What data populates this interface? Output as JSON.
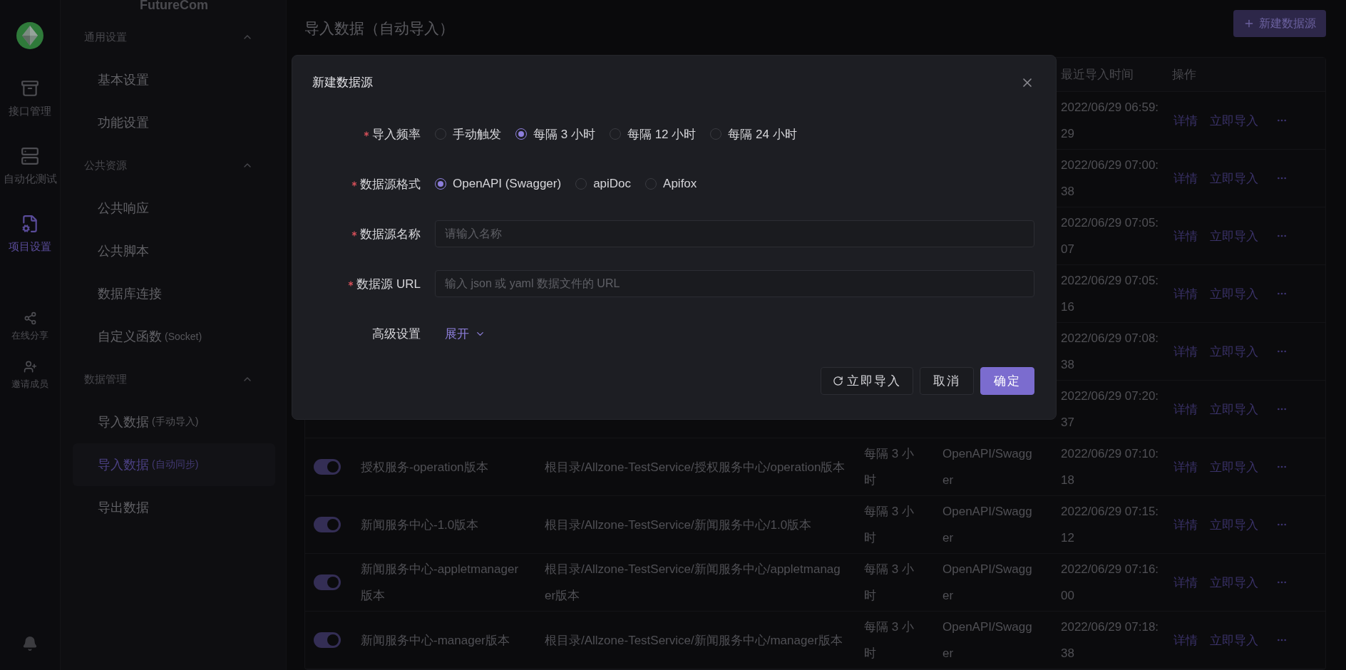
{
  "rail": {
    "nav": [
      {
        "kind": "api",
        "label": "接口管理",
        "selected": false
      },
      {
        "kind": "test",
        "label": "自动化测试",
        "selected": false
      },
      {
        "kind": "settings",
        "label": "项目设置",
        "selected": true
      }
    ],
    "tools": [
      {
        "kind": "share",
        "label": "在线分享"
      },
      {
        "kind": "invite",
        "label": "邀请成员"
      }
    ]
  },
  "sidebar": {
    "project": "FutureCom",
    "groups": [
      {
        "title": "通用设置",
        "expanded": true,
        "items": [
          {
            "label": "基本设置",
            "selected": false
          },
          {
            "label": "功能设置",
            "selected": false
          }
        ]
      },
      {
        "title": "公共资源",
        "expanded": true,
        "items": [
          {
            "label": "公共响应",
            "selected": false
          },
          {
            "label": "公共脚本",
            "selected": false
          },
          {
            "label": "数据库连接",
            "selected": false
          },
          {
            "label": "自定义函数",
            "note": "(Socket)",
            "selected": false
          }
        ]
      },
      {
        "title": "数据管理",
        "expanded": true,
        "items": [
          {
            "label": "导入数据",
            "note": "(手动导入)",
            "selected": false
          },
          {
            "label": "导入数据",
            "note": "(自动同步)",
            "selected": true
          },
          {
            "label": "导出数据",
            "selected": false
          }
        ]
      }
    ]
  },
  "page": {
    "title": "导入数据（自动导入）",
    "new_button": "新建数据源"
  },
  "table": {
    "header": {
      "time": "最近导入时间",
      "actions": "操作"
    },
    "rows": [
      {
        "time": "2022/06/29 06:59:29",
        "actions": [
          "详情",
          "立即导入"
        ]
      },
      {
        "time": "2022/06/29 07:00:38",
        "actions": [
          "详情",
          "立即导入"
        ]
      },
      {
        "time": "2022/06/29 07:05:07",
        "actions": [
          "详情",
          "立即导入"
        ]
      },
      {
        "time": "2022/06/29 07:05:16",
        "actions": [
          "详情",
          "立即导入"
        ]
      },
      {
        "time": "2022/06/29 07:08:38",
        "actions": [
          "详情",
          "立即导入"
        ]
      },
      {
        "time": "2022/06/29 07:20:37",
        "actions": [
          "详情",
          "立即导入"
        ]
      },
      {
        "enabled": true,
        "name": "授权服务-operation版本",
        "path": "根目录/Allzone-TestService/授权服务中心/operation版本",
        "frequency": "每隔 3 小时",
        "format": "OpenAPI/Swagger",
        "time": "2022/06/29 07:10:18",
        "actions": [
          "详情",
          "立即导入"
        ]
      },
      {
        "enabled": true,
        "name": "新闻服务中心-1.0版本",
        "path": "根目录/Allzone-TestService/新闻服务中心/1.0版本",
        "frequency": "每隔 3 小时",
        "format": "OpenAPI/Swagger",
        "time": "2022/06/29 07:15:12",
        "actions": [
          "详情",
          "立即导入"
        ]
      },
      {
        "enabled": true,
        "name": "新闻服务中心-appletmanager版本",
        "path": "根目录/Allzone-TestService/新闻服务中心/appletmanager版本",
        "frequency": "每隔 3 小时",
        "format": "OpenAPI/Swagger",
        "time": "2022/06/29 07:16:00",
        "actions": [
          "详情",
          "立即导入"
        ]
      },
      {
        "enabled": true,
        "name": "新闻服务中心-manager版本",
        "path": "根目录/Allzone-TestService/新闻服务中心/manager版本",
        "frequency": "每隔 3 小时",
        "format": "OpenAPI/Swagger",
        "time": "2022/06/29 07:18:38",
        "actions": [
          "详情",
          "立即导入"
        ]
      }
    ]
  },
  "dialog": {
    "title": "新建数据源",
    "fields": [
      {
        "kind": "radio",
        "label": "导入频率",
        "required": true,
        "options": [
          {
            "label": "手动触发",
            "selected": false
          },
          {
            "label": "每隔 3 小时",
            "selected": true
          },
          {
            "label": "每隔 12 小时",
            "selected": false
          },
          {
            "label": "每隔 24 小时",
            "selected": false
          }
        ]
      },
      {
        "kind": "radio",
        "label": "数据源格式",
        "required": true,
        "options": [
          {
            "label": "OpenAPI (Swagger)",
            "selected": true
          },
          {
            "label": "apiDoc",
            "selected": false
          },
          {
            "label": "Apifox",
            "selected": false
          }
        ]
      },
      {
        "kind": "input",
        "label": "数据源名称",
        "required": true,
        "placeholder": "请输入名称"
      },
      {
        "kind": "input",
        "label": "数据源 URL",
        "required": true,
        "placeholder": "输入 json 或 yaml 数据文件的 URL"
      },
      {
        "kind": "expand",
        "label": "高级设置",
        "required": false,
        "link": "展开",
        "expanded": false
      }
    ],
    "buttons": [
      {
        "kind": "import",
        "label": "立即导入"
      },
      {
        "kind": "cancel",
        "label": "取消"
      },
      {
        "kind": "primary",
        "label": "确定"
      }
    ]
  }
}
